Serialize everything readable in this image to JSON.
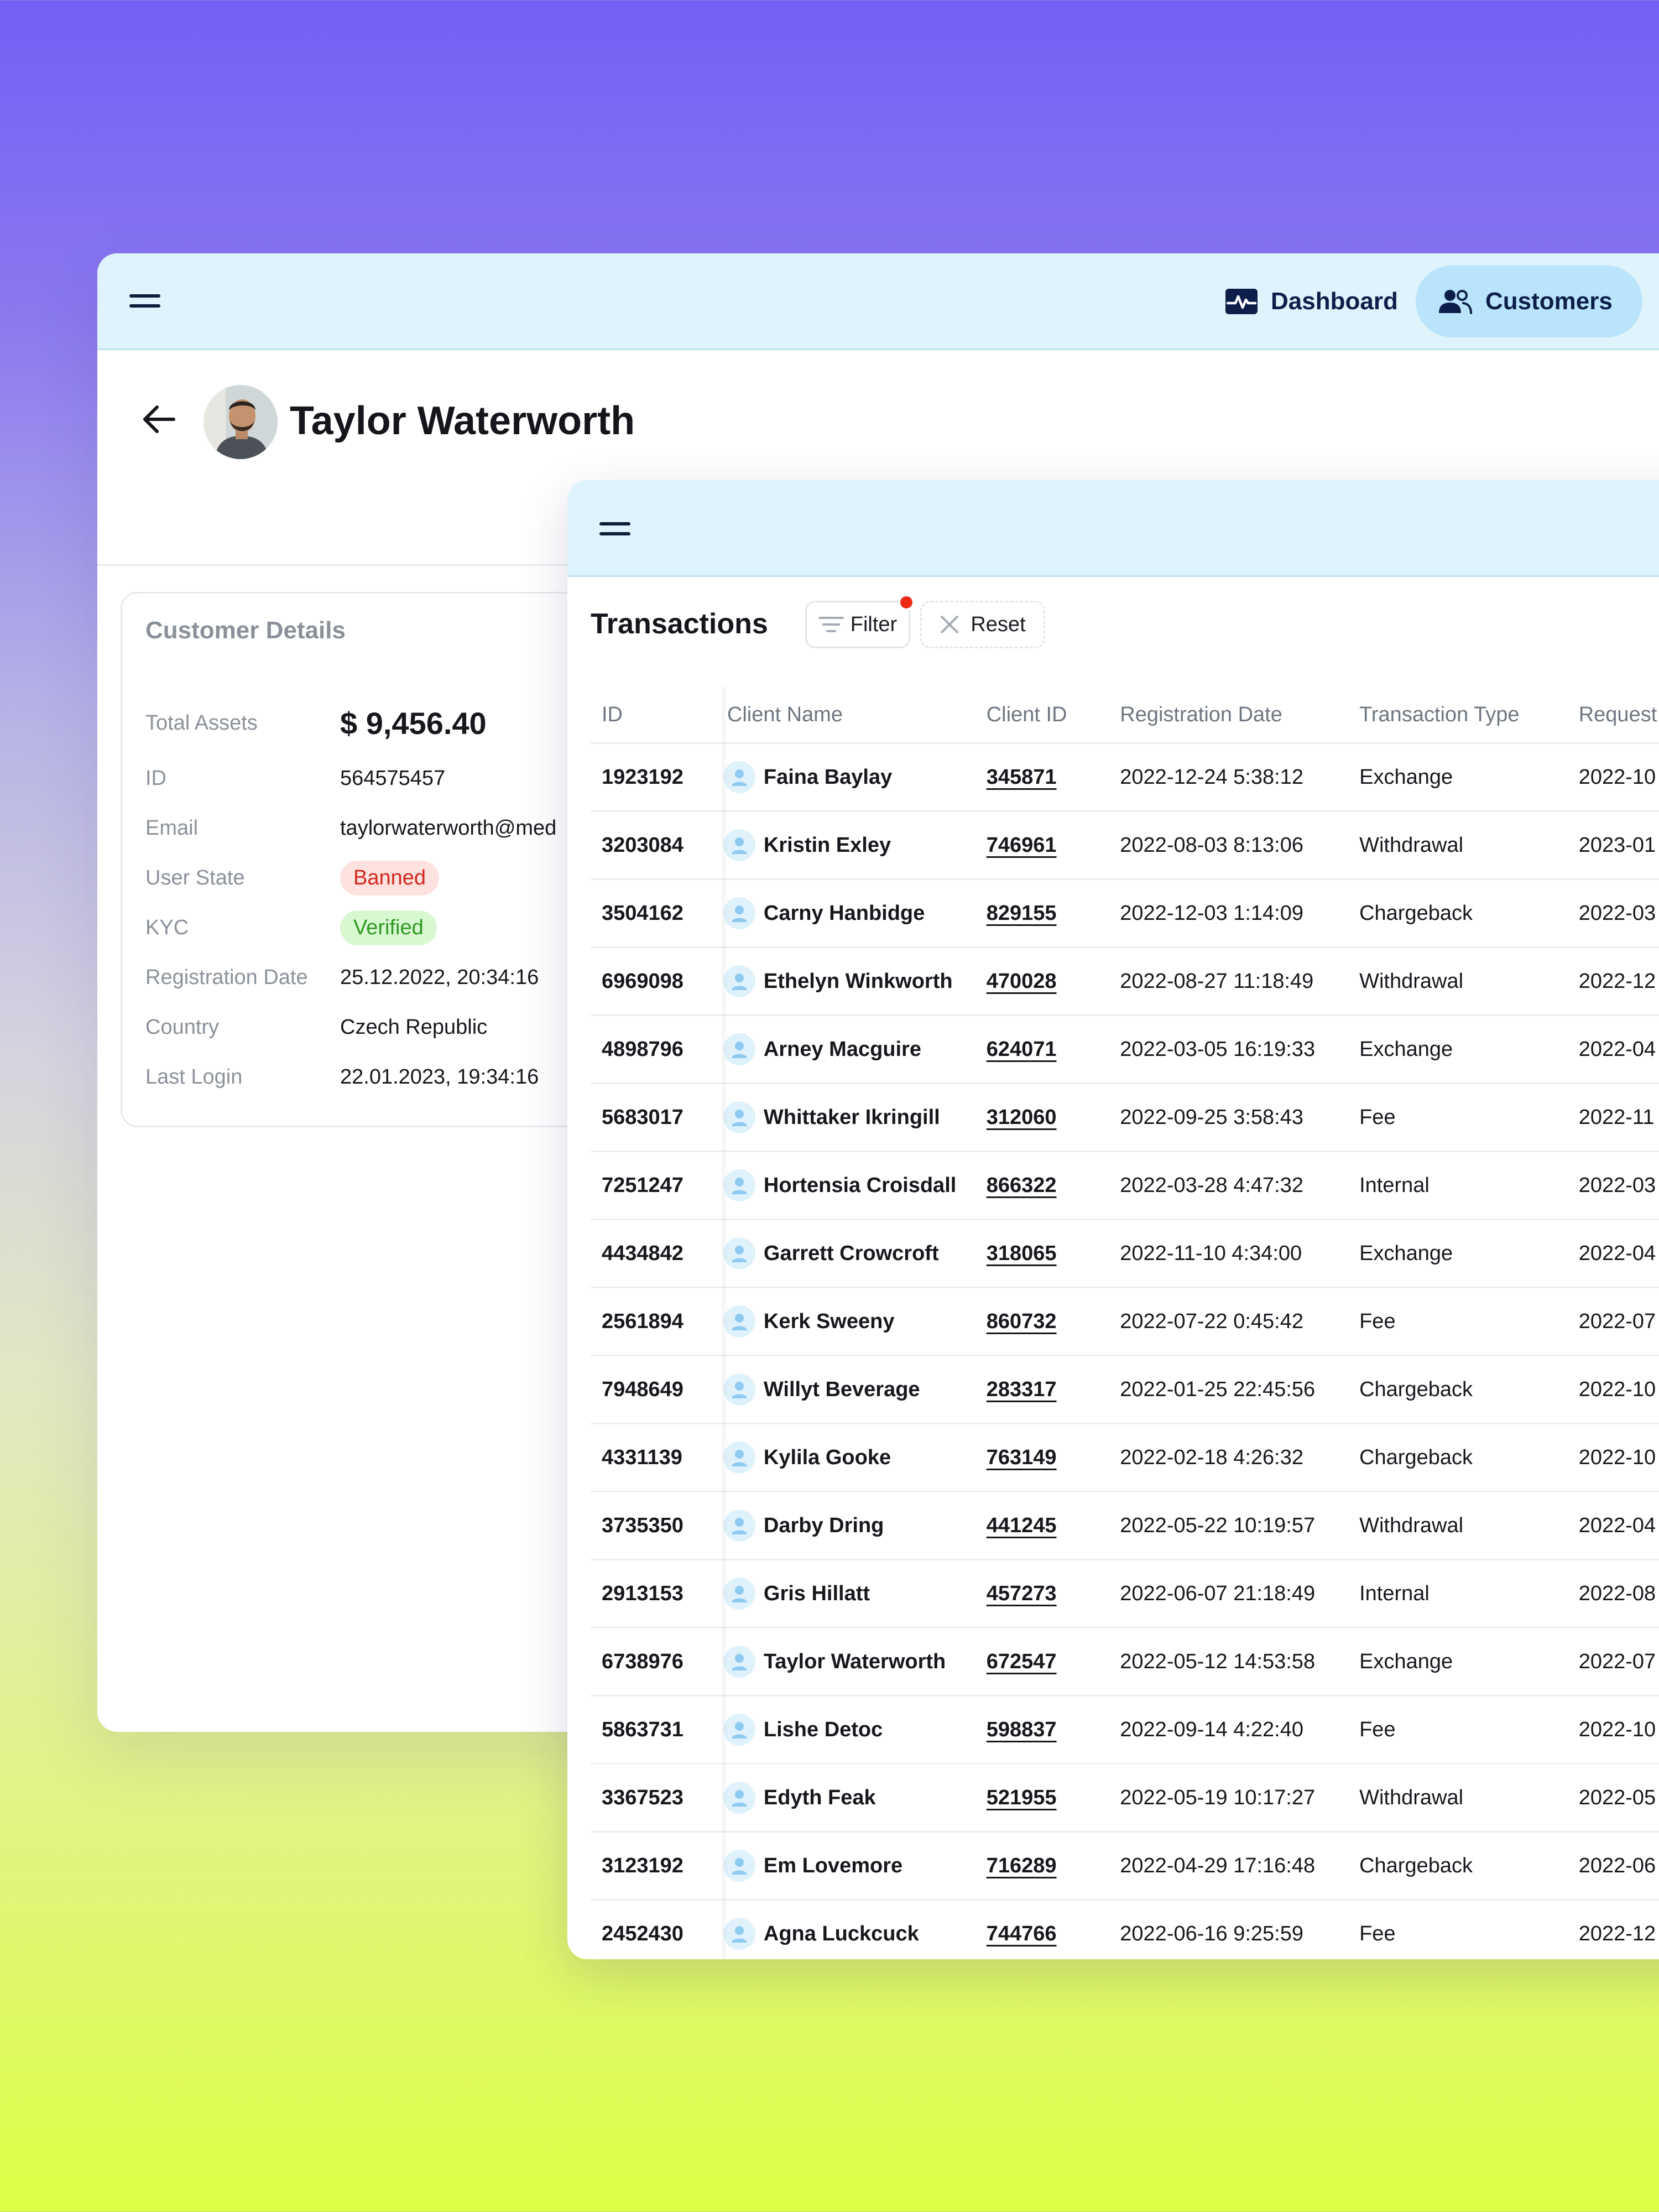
{
  "nav": {
    "dashboard_label": "Dashboard",
    "customers_label": "Customers"
  },
  "customer": {
    "name": "Taylor Waterworth",
    "card_title": "Customer Details",
    "fields": [
      {
        "label": "Total Assets",
        "value": "$ 9,456.40"
      },
      {
        "label": "ID",
        "value": "564575457"
      },
      {
        "label": "Email",
        "value": "taylorwaterworth@med"
      },
      {
        "label": "User State",
        "value": "Banned"
      },
      {
        "label": "KYC",
        "value": "Verified"
      },
      {
        "label": "Registration Date",
        "value": "25.12.2022, 20:34:16"
      },
      {
        "label": "Country",
        "value": "Czech Republic"
      },
      {
        "label": "Last Login",
        "value": "22.01.2023, 19:34:16"
      }
    ]
  },
  "transactions": {
    "title": "Transactions",
    "filter_label": "Filter",
    "reset_label": "Reset",
    "columns": [
      "ID",
      "Client Name",
      "Client ID",
      "Registration Date",
      "Transaction Type",
      "Request"
    ],
    "rows": [
      {
        "id": "1923192",
        "name": "Faina Baylay",
        "client_id": "345871",
        "reg_date": "2022-12-24 5:38:12",
        "type": "Exchange",
        "request": "2022-10"
      },
      {
        "id": "3203084",
        "name": "Kristin Exley",
        "client_id": "746961",
        "reg_date": "2022-08-03 8:13:06",
        "type": "Withdrawal",
        "request": "2023-01"
      },
      {
        "id": "3504162",
        "name": "Carny Hanbidge",
        "client_id": "829155",
        "reg_date": "2022-12-03 1:14:09",
        "type": "Chargeback",
        "request": "2022-03"
      },
      {
        "id": "6969098",
        "name": "Ethelyn Winkworth",
        "client_id": "470028",
        "reg_date": "2022-08-27 11:18:49",
        "type": "Withdrawal",
        "request": "2022-12"
      },
      {
        "id": "4898796",
        "name": "Arney Macguire",
        "client_id": "624071",
        "reg_date": "2022-03-05 16:19:33",
        "type": "Exchange",
        "request": "2022-04"
      },
      {
        "id": "5683017",
        "name": "Whittaker Ikringill",
        "client_id": "312060",
        "reg_date": "2022-09-25 3:58:43",
        "type": "Fee",
        "request": "2022-11"
      },
      {
        "id": "7251247",
        "name": "Hortensia Croisdall",
        "client_id": "866322",
        "reg_date": "2022-03-28 4:47:32",
        "type": "Internal",
        "request": "2022-03"
      },
      {
        "id": "4434842",
        "name": "Garrett Crowcroft",
        "client_id": "318065",
        "reg_date": "2022-11-10 4:34:00",
        "type": "Exchange",
        "request": "2022-04"
      },
      {
        "id": "2561894",
        "name": "Kerk Sweeny",
        "client_id": "860732",
        "reg_date": "2022-07-22 0:45:42",
        "type": "Fee",
        "request": "2022-07"
      },
      {
        "id": "7948649",
        "name": "Willyt Beverage",
        "client_id": "283317",
        "reg_date": "2022-01-25 22:45:56",
        "type": "Chargeback",
        "request": "2022-10"
      },
      {
        "id": "4331139",
        "name": "Kylila Gooke",
        "client_id": "763149",
        "reg_date": "2022-02-18 4:26:32",
        "type": "Chargeback",
        "request": "2022-10"
      },
      {
        "id": "3735350",
        "name": "Darby Dring",
        "client_id": "441245",
        "reg_date": "2022-05-22 10:19:57",
        "type": "Withdrawal",
        "request": "2022-04"
      },
      {
        "id": "2913153",
        "name": "Gris Hillatt",
        "client_id": "457273",
        "reg_date": "2022-06-07 21:18:49",
        "type": "Internal",
        "request": "2022-08"
      },
      {
        "id": "6738976",
        "name": "Taylor Waterworth",
        "client_id": "672547",
        "reg_date": "2022-05-12 14:53:58",
        "type": "Exchange",
        "request": "2022-07"
      },
      {
        "id": "5863731",
        "name": "Lishe Detoc",
        "client_id": "598837",
        "reg_date": "2022-09-14 4:22:40",
        "type": "Fee",
        "request": "2022-10"
      },
      {
        "id": "3367523",
        "name": "Edyth Feak",
        "client_id": "521955",
        "reg_date": "2022-05-19 10:17:27",
        "type": "Withdrawal",
        "request": "2022-05"
      },
      {
        "id": "3123192",
        "name": "Em Lovemore",
        "client_id": "716289",
        "reg_date": "2022-04-29 17:16:48",
        "type": "Chargeback",
        "request": "2022-06"
      },
      {
        "id": "2452430",
        "name": "Agna Luckcuck",
        "client_id": "744766",
        "reg_date": "2022-06-16 9:25:59",
        "type": "Fee",
        "request": "2022-12"
      }
    ]
  }
}
